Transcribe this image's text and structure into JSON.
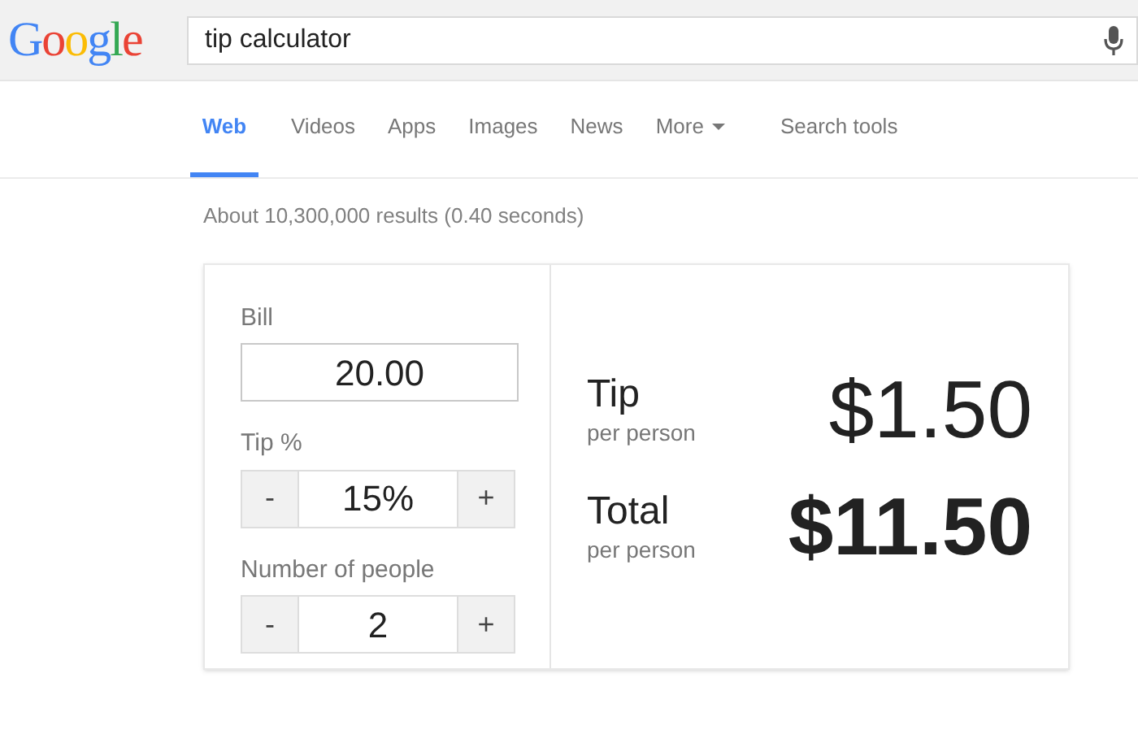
{
  "logo": "Google",
  "search": {
    "value": "tip calculator"
  },
  "tabs": [
    {
      "label": "Web",
      "selected": true,
      "kind": "tab"
    },
    {
      "label": "Videos",
      "selected": false,
      "kind": "tab"
    },
    {
      "label": "Apps",
      "selected": false,
      "kind": "tab"
    },
    {
      "label": "Images",
      "selected": false,
      "kind": "tab"
    },
    {
      "label": "News",
      "selected": false,
      "kind": "tab"
    },
    {
      "label": "More",
      "selected": false,
      "kind": "menu"
    },
    {
      "label": "Search tools",
      "selected": false,
      "kind": "tab"
    }
  ],
  "result_stats": "About 10,300,000 results (0.40 seconds)",
  "calculator": {
    "bill": {
      "label": "Bill",
      "value": "20.00"
    },
    "tip": {
      "label": "Tip %",
      "value": "15%",
      "minus": "-",
      "plus": "+"
    },
    "people": {
      "label": "Number of people",
      "value": "2",
      "minus": "-",
      "plus": "+"
    },
    "results": [
      {
        "label": "Tip",
        "sub": "per person",
        "amount": "$1.50",
        "bold": false
      },
      {
        "label": "Total",
        "sub": "per person",
        "amount": "$11.50",
        "bold": true
      }
    ]
  }
}
